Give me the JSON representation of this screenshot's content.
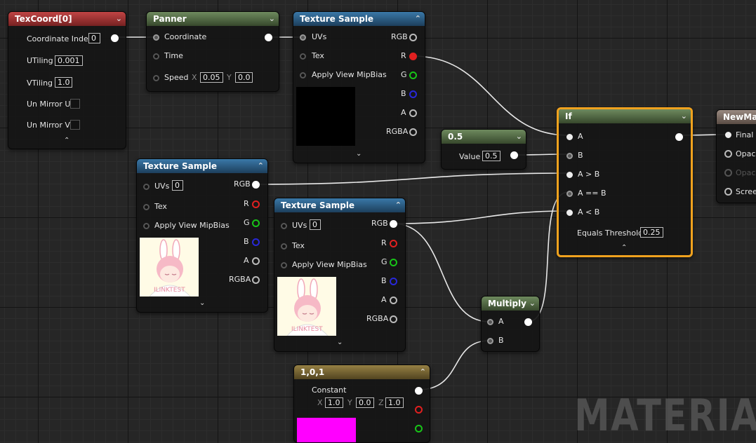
{
  "watermark": "MATERIAL",
  "texcoord": {
    "title": "TexCoord[0]",
    "coordinate_index_label": "Coordinate Index",
    "coordinate_index": "0",
    "utiling_label": "UTiling",
    "utiling": "0.001",
    "vtiling_label": "VTiling",
    "vtiling": "1.0",
    "unmirror_u_label": "Un Mirror U",
    "unmirror_v_label": "Un Mirror V"
  },
  "panner": {
    "title": "Panner",
    "coordinate_label": "Coordinate",
    "time_label": "Time",
    "speed_label": "Speed",
    "x_label": "X",
    "speed_x": "0.05",
    "y_label": "Y",
    "speed_y": "0.0"
  },
  "texsample1": {
    "title": "Texture Sample",
    "uvs_label": "UVs",
    "tex_label": "Tex",
    "mip_label": "Apply View MipBias",
    "rgb": "RGB",
    "r": "R",
    "g": "G",
    "b": "B",
    "a": "A",
    "rgba": "RGBA"
  },
  "texsample2": {
    "title": "Texture Sample",
    "uvs_label": "UVs",
    "uvs_value": "0",
    "tex_label": "Tex",
    "mip_label": "Apply View MipBias",
    "rgb": "RGB",
    "r": "R",
    "g": "G",
    "b": "B",
    "a": "A",
    "rgba": "RGBA",
    "thumb_text": "ILINKTEST"
  },
  "texsample3": {
    "title": "Texture Sample",
    "uvs_label": "UVs",
    "uvs_value": "0",
    "tex_label": "Tex",
    "mip_label": "Apply View MipBias",
    "rgb": "RGB",
    "r": "R",
    "g": "G",
    "b": "B",
    "a": "A",
    "rgba": "RGBA",
    "thumb_text": "ILINKTEST"
  },
  "half": {
    "title": "0.5",
    "value_label": "Value",
    "value": "0.5"
  },
  "ifnode": {
    "title": "If",
    "a_label": "A",
    "b_label": "B",
    "agb_label": "A > B",
    "aeb_label": "A == B",
    "alb_label": "A < B",
    "threshold_label": "Equals Threshold",
    "threshold": "0.25"
  },
  "material": {
    "title": "NewMate",
    "final_label": "Final C",
    "opacity_label": "Opaci",
    "opacity_mask_label": "Opaci",
    "screen_label": "Scree"
  },
  "multiply": {
    "title": "Multiply",
    "a_label": "A",
    "b_label": "B"
  },
  "constant": {
    "title": "1,0,1",
    "label": "Constant",
    "x_label": "X",
    "x": "1.0",
    "y_label": "Y",
    "y": "0.0",
    "z_label": "Z",
    "z": "1.0",
    "swatch_color": "#ff00ff"
  },
  "colors": {
    "selection": "#f0a21e",
    "wire": "#e8e8e8",
    "pin_r": "#e02020",
    "pin_g": "#18c418",
    "pin_b": "#2828d8"
  }
}
